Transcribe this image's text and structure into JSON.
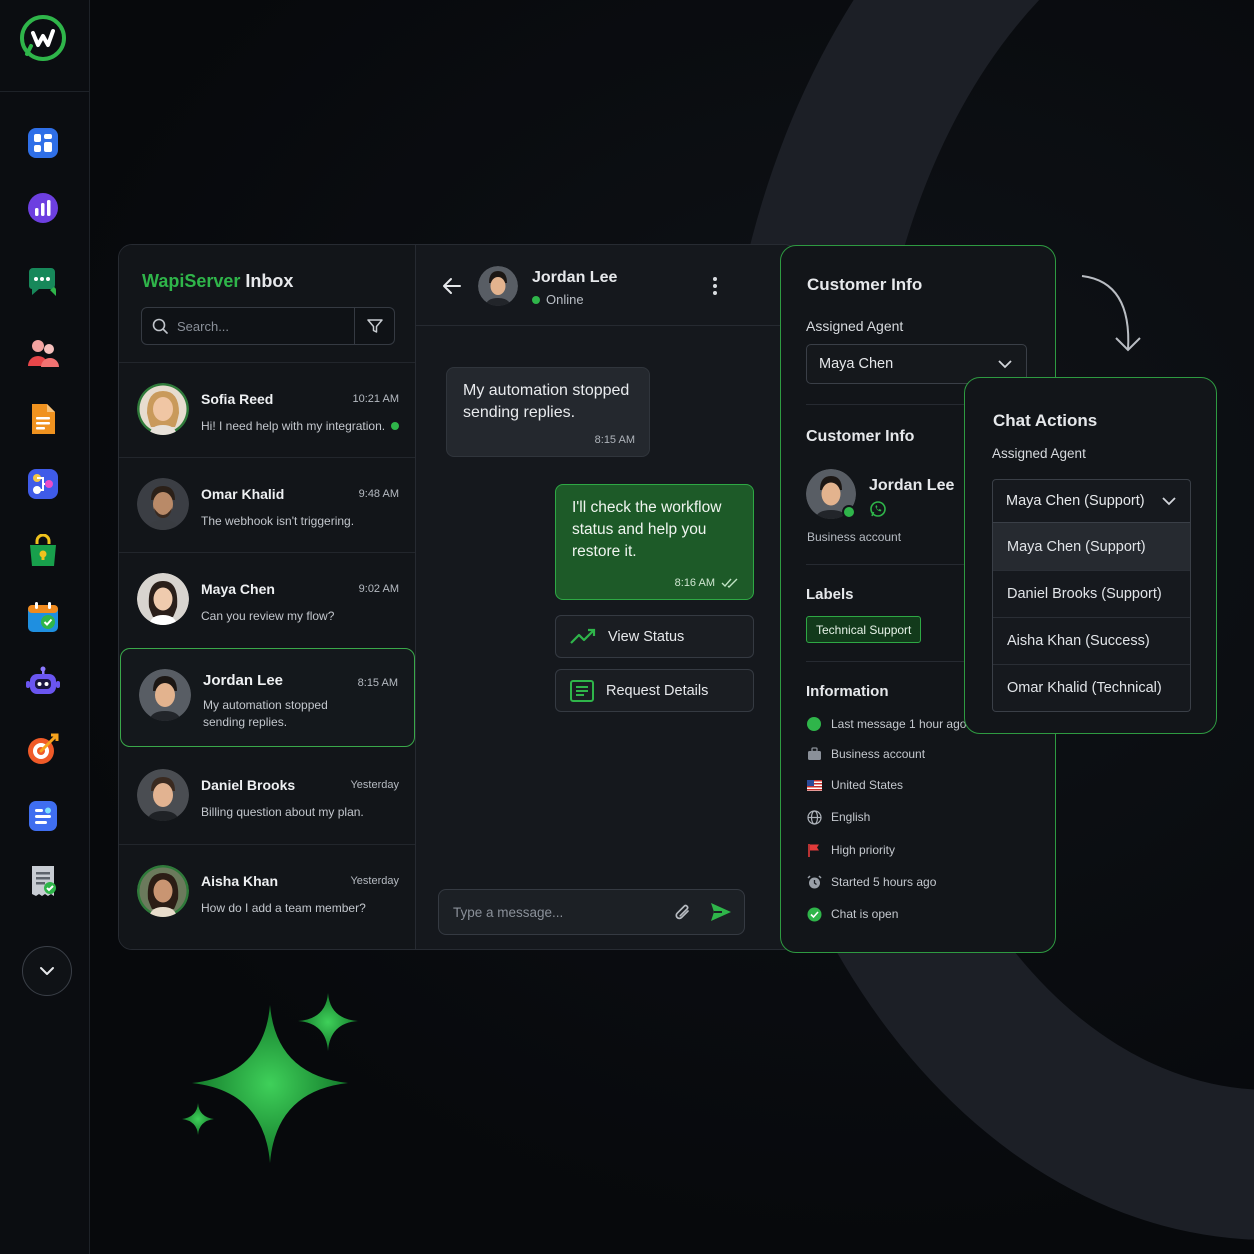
{
  "app": {
    "brand": "WapiServer",
    "title_suffix": "Inbox"
  },
  "colors": {
    "accent": "#2fb54a",
    "background": "#080a0d",
    "panel": "#13161b"
  },
  "rail": {
    "icons": [
      "dashboard-icon",
      "analytics-icon",
      "chat-icon",
      "contacts-icon",
      "documents-icon",
      "flows-icon",
      "store-icon",
      "calendar-icon",
      "bot-icon",
      "campaigns-icon",
      "templates-icon",
      "reports-icon"
    ],
    "collapse_icon": "chevron-down-icon"
  },
  "inbox": {
    "search_placeholder": "Search...",
    "conversations": [
      {
        "name": "Sofia Reed",
        "time": "10:21 AM",
        "message": "Hi! I need help with my integration.",
        "unread": true
      },
      {
        "name": "Omar Khalid",
        "time": "9:48 AM",
        "message": "The webhook isn't triggering."
      },
      {
        "name": "Maya Chen",
        "time": "9:02 AM",
        "message": "Can you review my flow?"
      },
      {
        "name": "Jordan Lee",
        "time": "8:15 AM",
        "message": "My automation stopped sending replies.",
        "active": true
      },
      {
        "name": "Daniel Brooks",
        "time": "Yesterday",
        "message": "Billing question about my plan."
      },
      {
        "name": "Aisha Khan",
        "time": "Yesterday",
        "message": "How do I add a team member?"
      }
    ]
  },
  "chat": {
    "contact_name": "Jordan Lee",
    "contact_status": "Online",
    "messages": [
      {
        "direction": "in",
        "text": "My automation stopped sending replies.",
        "time": "8:15 AM"
      },
      {
        "direction": "out",
        "text": "I'll check the workflow status and help you restore it.",
        "time": "8:16 AM"
      }
    ],
    "quick_actions": [
      "View Status",
      "Request Details"
    ],
    "composer_placeholder": "Type a message..."
  },
  "customer_info": {
    "title": "Customer Info",
    "assigned_agent_label": "Assigned Agent",
    "assigned_agent": "Maya Chen",
    "section_title": "Customer Info",
    "name": "Jordan Lee",
    "account_type": "Business account",
    "labels_title": "Labels",
    "label": "Technical Support",
    "information_title": "Information",
    "information": [
      {
        "icon": "status-dot-icon",
        "text": "Last message 1 hour ago"
      },
      {
        "icon": "briefcase-icon",
        "text": "Business account"
      },
      {
        "icon": "us-flag-icon",
        "text": "United States"
      },
      {
        "icon": "globe-icon",
        "text": "English"
      },
      {
        "icon": "red-flag-icon",
        "text": "High priority"
      },
      {
        "icon": "alarm-clock-icon",
        "text": "Started 5 hours ago"
      },
      {
        "icon": "check-circle-icon",
        "text": "Chat is open"
      }
    ]
  },
  "chat_actions": {
    "title": "Chat Actions",
    "assigned_agent_label": "Assigned Agent",
    "selected": "Maya Chen (Support)",
    "options": [
      "Maya Chen (Support)",
      "Daniel Brooks (Support)",
      "Aisha Khan (Success)",
      "Omar Khalid (Technical)"
    ]
  }
}
